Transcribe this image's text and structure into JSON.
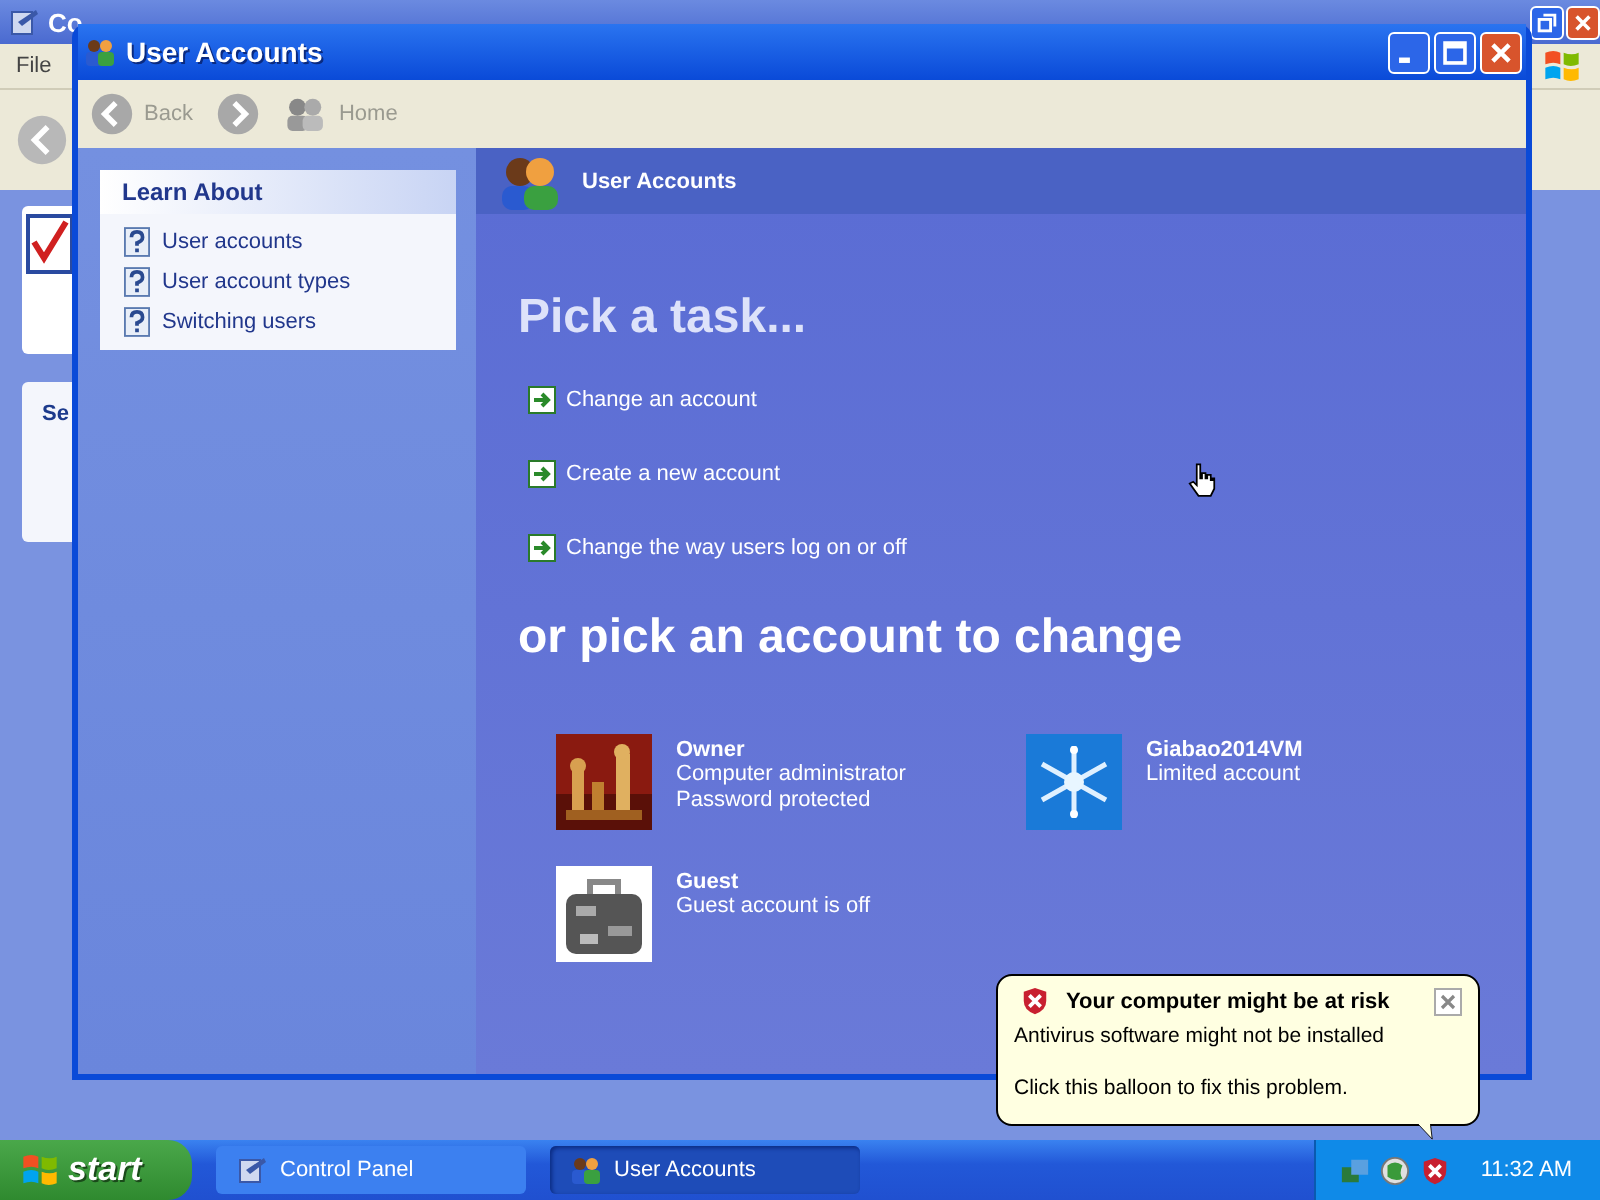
{
  "background_window": {
    "title": "Co",
    "menu": [
      "File"
    ],
    "panel_title": "Se"
  },
  "window": {
    "title": "User Accounts"
  },
  "toolbar": [
    {
      "kind": "back",
      "label": "Back",
      "disabled": true
    },
    {
      "kind": "forward",
      "disabled": true
    },
    {
      "kind": "home",
      "label": "Home",
      "disabled": true
    }
  ],
  "learn_about": {
    "title": "Learn About",
    "items": [
      "User accounts",
      "User account types",
      "Switching users"
    ]
  },
  "header": {
    "title": "User Accounts"
  },
  "task_heading": "Pick a task...",
  "tasks": [
    "Change an account",
    "Create a new account",
    "Change the way users log on or off"
  ],
  "account_heading": "or pick an account to change",
  "accounts": [
    {
      "name": "Owner",
      "details": [
        "Computer administrator",
        "Password protected"
      ]
    },
    {
      "name": "Giabao2014VM",
      "details": [
        "Limited account"
      ]
    },
    {
      "name": "Guest",
      "details": [
        "Guest account is off"
      ]
    }
  ],
  "balloon": {
    "title": "Your computer might be at risk",
    "lines": [
      "Antivirus software might not be installed",
      "Click this balloon to fix this problem."
    ]
  },
  "taskbar": {
    "start": "start",
    "tasks": [
      {
        "label": "Control Panel",
        "selected": false
      },
      {
        "label": "User Accounts",
        "selected": true
      }
    ],
    "clock": "11:32 AM"
  }
}
